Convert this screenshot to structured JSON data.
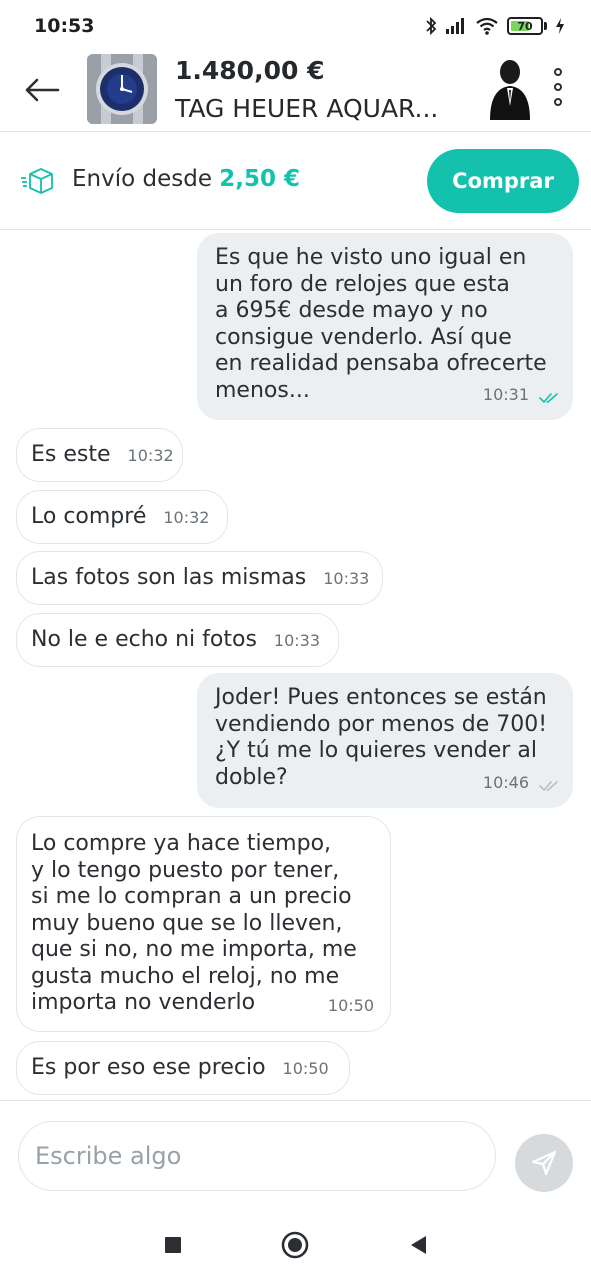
{
  "status_bar": {
    "time": "10:53",
    "battery_level": 70,
    "battery_text": "70",
    "icons": [
      "bluetooth-icon",
      "signal-icon",
      "wifi-icon",
      "battery-icon",
      "charging-icon"
    ]
  },
  "header": {
    "price": "1.480,00 €",
    "title": "TAG HEUER AQUAR...",
    "icons": [
      "back-arrow-icon",
      "product-thumbnail",
      "user-avatar",
      "more-options-icon"
    ]
  },
  "shipping": {
    "label": "Envío desde",
    "price": "2,50 €",
    "buy_label": "Comprar",
    "icon": "package-icon"
  },
  "messages": [
    {
      "direction": "out",
      "text": "Es que he visto uno igual en\nun foro de relojes que esta\na 695€ desde mayo y no\nconsigue venderlo. Así que\nen realidad pensaba ofrecerte\nmenos...",
      "time": "10:31",
      "read": true
    },
    {
      "direction": "in",
      "text": "Es este",
      "time": "10:32"
    },
    {
      "direction": "in",
      "text": "Lo compré",
      "time": "10:32"
    },
    {
      "direction": "in",
      "text": "Las fotos son las mismas",
      "time": "10:33"
    },
    {
      "direction": "in",
      "text": "No le e echo ni fotos",
      "time": "10:33"
    },
    {
      "direction": "out",
      "text": "Joder! Pues entonces se están\nvendiendo por menos de 700!\n¿Y tú me lo quieres vender al\ndoble?",
      "time": "10:46",
      "read": false
    },
    {
      "direction": "in",
      "text": "Lo compre ya hace tiempo,\ny lo tengo puesto por tener,\nsi me lo compran a un precio\nmuy bueno que se lo lleven,\nque si no, no me importa, me\ngusta mucho el reloj, no me\nimporta no venderlo",
      "time": "10:50"
    },
    {
      "direction": "in",
      "text": "Es por eso ese precio",
      "time": "10:50"
    }
  ],
  "composer": {
    "placeholder": "Escribe algo",
    "send_icon": "send-icon"
  },
  "colors": {
    "accent": "#13c1ac",
    "bubble_out": "#eceff1",
    "bubble_in_border": "#e3e6e8",
    "read_tick": "#13c1ac",
    "unread_tick": "#b8bec2"
  }
}
